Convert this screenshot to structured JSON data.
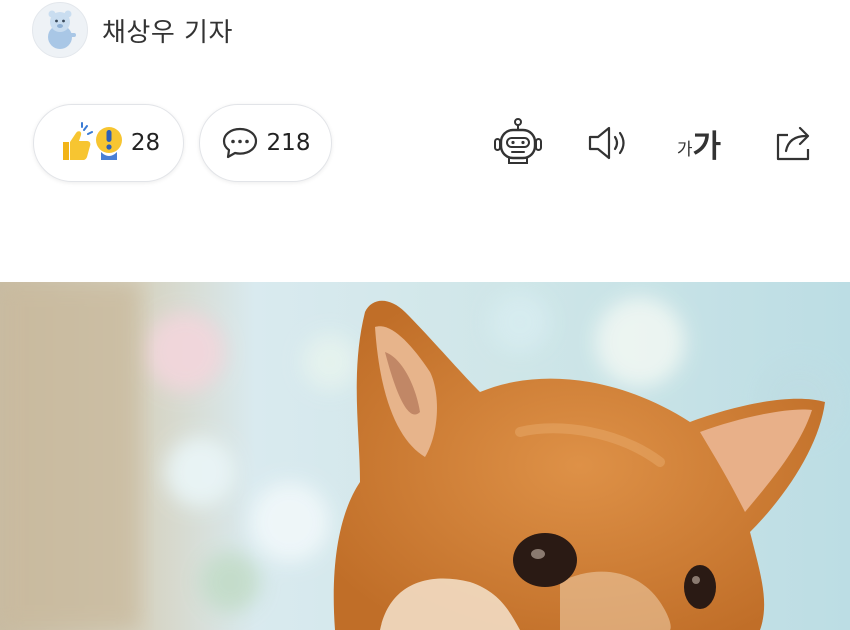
{
  "author": {
    "name": "채상우 기자",
    "avatar_icon": "cartoon-bear-avatar-icon"
  },
  "actions": {
    "reaction": {
      "icon": "thumbs-up-exclamation-icon",
      "count": "28"
    },
    "comment": {
      "icon": "speech-bubble-icon",
      "count": "218"
    }
  },
  "toolbar": {
    "ai_icon": "robot-icon",
    "sound_icon": "speaker-icon",
    "font_small": "가",
    "font_large": "가",
    "share_icon": "share-icon"
  },
  "photo": {
    "subject": "shiba-inu-dog-photo",
    "colors": {
      "fur": "#d0813a",
      "background": "#cfe4ea"
    }
  }
}
